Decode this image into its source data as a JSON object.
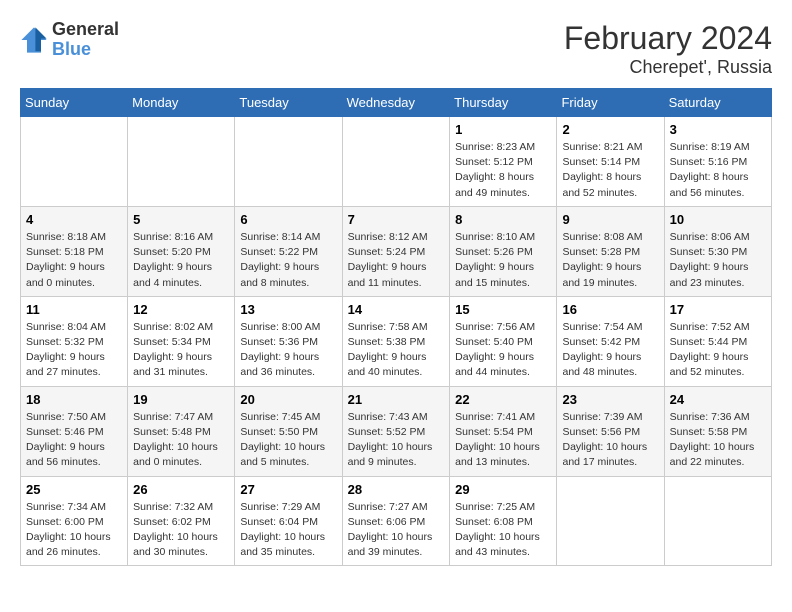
{
  "header": {
    "logo_line1": "General",
    "logo_line2": "Blue",
    "title": "February 2024",
    "subtitle": "Cherepet', Russia"
  },
  "columns": [
    "Sunday",
    "Monday",
    "Tuesday",
    "Wednesday",
    "Thursday",
    "Friday",
    "Saturday"
  ],
  "weeks": [
    [
      {
        "day": "",
        "detail": ""
      },
      {
        "day": "",
        "detail": ""
      },
      {
        "day": "",
        "detail": ""
      },
      {
        "day": "",
        "detail": ""
      },
      {
        "day": "1",
        "detail": "Sunrise: 8:23 AM\nSunset: 5:12 PM\nDaylight: 8 hours\nand 49 minutes."
      },
      {
        "day": "2",
        "detail": "Sunrise: 8:21 AM\nSunset: 5:14 PM\nDaylight: 8 hours\nand 52 minutes."
      },
      {
        "day": "3",
        "detail": "Sunrise: 8:19 AM\nSunset: 5:16 PM\nDaylight: 8 hours\nand 56 minutes."
      }
    ],
    [
      {
        "day": "4",
        "detail": "Sunrise: 8:18 AM\nSunset: 5:18 PM\nDaylight: 9 hours\nand 0 minutes."
      },
      {
        "day": "5",
        "detail": "Sunrise: 8:16 AM\nSunset: 5:20 PM\nDaylight: 9 hours\nand 4 minutes."
      },
      {
        "day": "6",
        "detail": "Sunrise: 8:14 AM\nSunset: 5:22 PM\nDaylight: 9 hours\nand 8 minutes."
      },
      {
        "day": "7",
        "detail": "Sunrise: 8:12 AM\nSunset: 5:24 PM\nDaylight: 9 hours\nand 11 minutes."
      },
      {
        "day": "8",
        "detail": "Sunrise: 8:10 AM\nSunset: 5:26 PM\nDaylight: 9 hours\nand 15 minutes."
      },
      {
        "day": "9",
        "detail": "Sunrise: 8:08 AM\nSunset: 5:28 PM\nDaylight: 9 hours\nand 19 minutes."
      },
      {
        "day": "10",
        "detail": "Sunrise: 8:06 AM\nSunset: 5:30 PM\nDaylight: 9 hours\nand 23 minutes."
      }
    ],
    [
      {
        "day": "11",
        "detail": "Sunrise: 8:04 AM\nSunset: 5:32 PM\nDaylight: 9 hours\nand 27 minutes."
      },
      {
        "day": "12",
        "detail": "Sunrise: 8:02 AM\nSunset: 5:34 PM\nDaylight: 9 hours\nand 31 minutes."
      },
      {
        "day": "13",
        "detail": "Sunrise: 8:00 AM\nSunset: 5:36 PM\nDaylight: 9 hours\nand 36 minutes."
      },
      {
        "day": "14",
        "detail": "Sunrise: 7:58 AM\nSunset: 5:38 PM\nDaylight: 9 hours\nand 40 minutes."
      },
      {
        "day": "15",
        "detail": "Sunrise: 7:56 AM\nSunset: 5:40 PM\nDaylight: 9 hours\nand 44 minutes."
      },
      {
        "day": "16",
        "detail": "Sunrise: 7:54 AM\nSunset: 5:42 PM\nDaylight: 9 hours\nand 48 minutes."
      },
      {
        "day": "17",
        "detail": "Sunrise: 7:52 AM\nSunset: 5:44 PM\nDaylight: 9 hours\nand 52 minutes."
      }
    ],
    [
      {
        "day": "18",
        "detail": "Sunrise: 7:50 AM\nSunset: 5:46 PM\nDaylight: 9 hours\nand 56 minutes."
      },
      {
        "day": "19",
        "detail": "Sunrise: 7:47 AM\nSunset: 5:48 PM\nDaylight: 10 hours\nand 0 minutes."
      },
      {
        "day": "20",
        "detail": "Sunrise: 7:45 AM\nSunset: 5:50 PM\nDaylight: 10 hours\nand 5 minutes."
      },
      {
        "day": "21",
        "detail": "Sunrise: 7:43 AM\nSunset: 5:52 PM\nDaylight: 10 hours\nand 9 minutes."
      },
      {
        "day": "22",
        "detail": "Sunrise: 7:41 AM\nSunset: 5:54 PM\nDaylight: 10 hours\nand 13 minutes."
      },
      {
        "day": "23",
        "detail": "Sunrise: 7:39 AM\nSunset: 5:56 PM\nDaylight: 10 hours\nand 17 minutes."
      },
      {
        "day": "24",
        "detail": "Sunrise: 7:36 AM\nSunset: 5:58 PM\nDaylight: 10 hours\nand 22 minutes."
      }
    ],
    [
      {
        "day": "25",
        "detail": "Sunrise: 7:34 AM\nSunset: 6:00 PM\nDaylight: 10 hours\nand 26 minutes."
      },
      {
        "day": "26",
        "detail": "Sunrise: 7:32 AM\nSunset: 6:02 PM\nDaylight: 10 hours\nand 30 minutes."
      },
      {
        "day": "27",
        "detail": "Sunrise: 7:29 AM\nSunset: 6:04 PM\nDaylight: 10 hours\nand 35 minutes."
      },
      {
        "day": "28",
        "detail": "Sunrise: 7:27 AM\nSunset: 6:06 PM\nDaylight: 10 hours\nand 39 minutes."
      },
      {
        "day": "29",
        "detail": "Sunrise: 7:25 AM\nSunset: 6:08 PM\nDaylight: 10 hours\nand 43 minutes."
      },
      {
        "day": "",
        "detail": ""
      },
      {
        "day": "",
        "detail": ""
      }
    ]
  ]
}
